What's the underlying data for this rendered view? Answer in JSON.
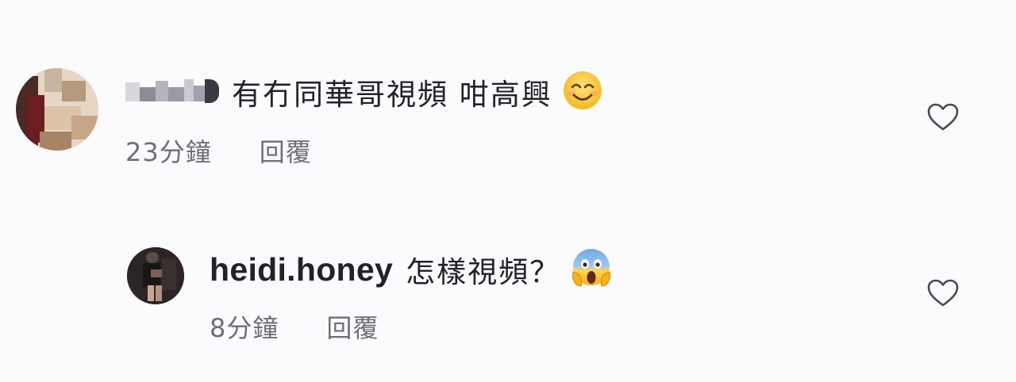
{
  "comments": [
    {
      "username": "",
      "username_blurred": true,
      "text": "有冇同華哥視頻 咁高興",
      "emoji": "smiling-face-icon",
      "time": "23分鐘",
      "reply_label": "回覆",
      "like_icon": "heart-outline-icon"
    },
    {
      "username": "heidi.honey",
      "username_blurred": false,
      "text": "怎樣視頻？",
      "emoji": "screaming-face-icon",
      "time": "8分鐘",
      "reply_label": "回覆",
      "like_icon": "heart-outline-icon"
    }
  ],
  "colors": {
    "background": "#fbfbfd",
    "text": "#22222a",
    "meta": "#6e6e78",
    "icon": "#4a4a52"
  }
}
